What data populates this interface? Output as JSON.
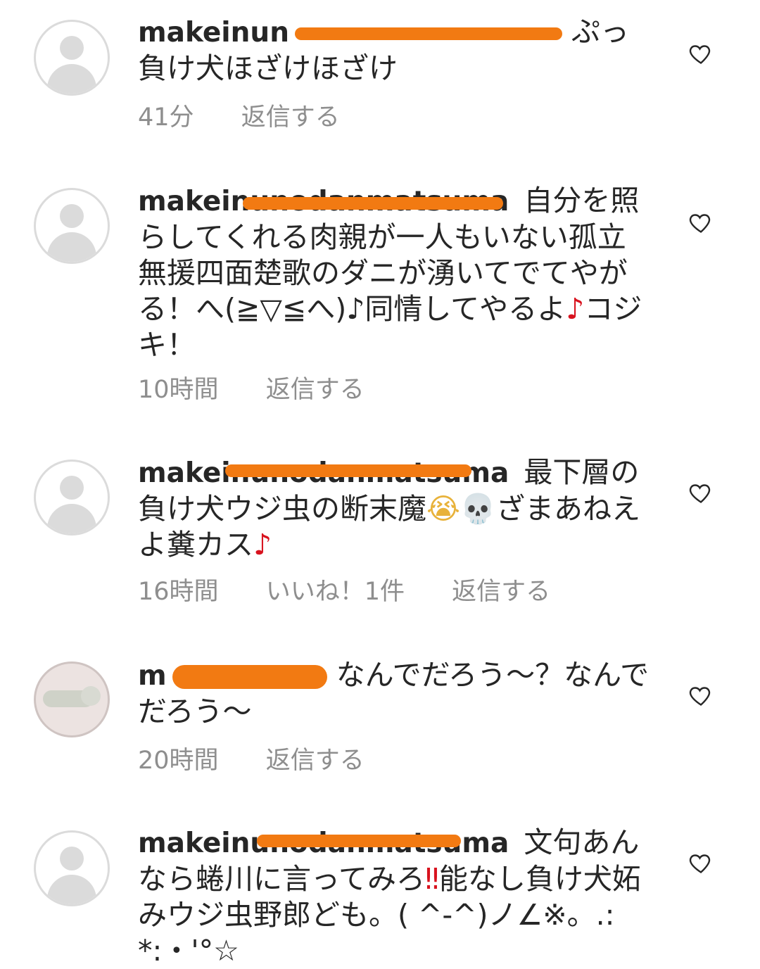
{
  "comments": [
    {
      "username": "makeinun",
      "text_before": "",
      "text": "ぷっ  負け犬ほざけほざけ",
      "time": "41分",
      "likes": "",
      "reply": "返信する"
    },
    {
      "username": "makeinunodanmatsuma",
      "text": "自分を照らしてくれる肉親が一人もいない孤立無援四面楚歌のダニが湧いてでてやがる！へ(≧▽≦へ)♪同情してやるよ",
      "note_icon": "♪",
      "text_after": "コジキ！",
      "time": "10時間",
      "likes": "",
      "reply": "返信する"
    },
    {
      "username": "makeinunodanmatsuma",
      "text": "最下層の負け犬ウジ虫の断末魔",
      "emoji_1": "😭",
      "emoji_2": "💀",
      "text_after": "ざまあねえよ糞カス",
      "note_icon": "♪",
      "time": "16時間",
      "likes": "いいね！1件",
      "reply": "返信する"
    },
    {
      "username": "m",
      "text": "なんでだろう～？なんでだろう～",
      "time": "20時間",
      "likes": "",
      "reply": "返信する"
    },
    {
      "username": "makeinunodanmatsuma",
      "text": "文句あんなら蜷川に言ってみろ",
      "exclaim": "‼",
      "text_after": "能なし負け犬妬みウジ虫野郎ども。( ^-^)ノ∠※。.:*:・'°☆",
      "time": "",
      "likes": "",
      "reply": ""
    }
  ],
  "colors": {
    "text": "#262626",
    "meta": "#8e8e8e",
    "redaction": "#f27a12",
    "avatar_border": "#dbdbdb",
    "note": "#d8121e"
  },
  "icons": {
    "like": "heart-outline-icon",
    "avatar": "default-user-avatar"
  }
}
